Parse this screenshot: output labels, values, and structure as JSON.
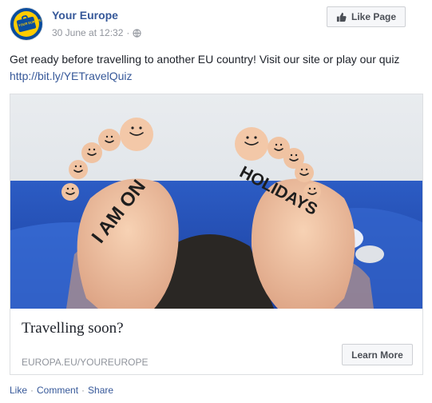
{
  "post": {
    "page_name": "Your Europe",
    "avatar_text": "YOUR EUROPE",
    "timestamp": "30 June at 12:32",
    "separator": "·",
    "like_page_label": "Like Page",
    "text": "Get ready before travelling to another EU country! Visit our site or play our quiz ",
    "link": "http://bit.ly/YETravelQuiz"
  },
  "card": {
    "image_text_left": "I AM ON",
    "image_text_right": "HOLIDAYS",
    "title": "Travelling soon?",
    "domain": "EUROPA.EU/YOUREUROPE",
    "cta_label": "Learn More"
  },
  "actions": {
    "like": "Like",
    "comment": "Comment",
    "share": "Share",
    "dot": "·"
  },
  "colors": {
    "link": "#365899",
    "meta": "#90949c",
    "text": "#1d2129",
    "button_bg": "#f6f7f9"
  }
}
